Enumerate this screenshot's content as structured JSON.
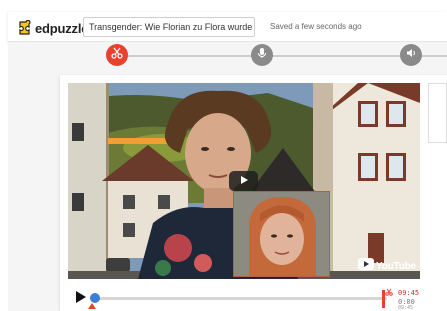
{
  "app": {
    "brand": "edpuzzle",
    "video_title": "Transgender: Wie Florian zu Flora wurde (Ne",
    "save_status": "Saved a few seconds ago"
  },
  "tools": [
    {
      "name": "cut",
      "icon": "scissors-icon",
      "active": true,
      "color": "#e8422f"
    },
    {
      "name": "voiceover",
      "icon": "microphone-icon",
      "active": false,
      "color": "#8a8a8a"
    },
    {
      "name": "audio-notes",
      "icon": "speaker-icon",
      "active": false,
      "color": "#8a8a8a"
    }
  ],
  "video": {
    "platform_label": "YouTube",
    "play_icon": "play-icon"
  },
  "player": {
    "progress": 0.0,
    "end_time": "09:45",
    "total_time": "0:00",
    "duration_small": "09:45"
  },
  "colors": {
    "accent_red": "#e8422f",
    "progress_blue": "#3d7fd6",
    "logo_yellow": "#f5c518"
  }
}
